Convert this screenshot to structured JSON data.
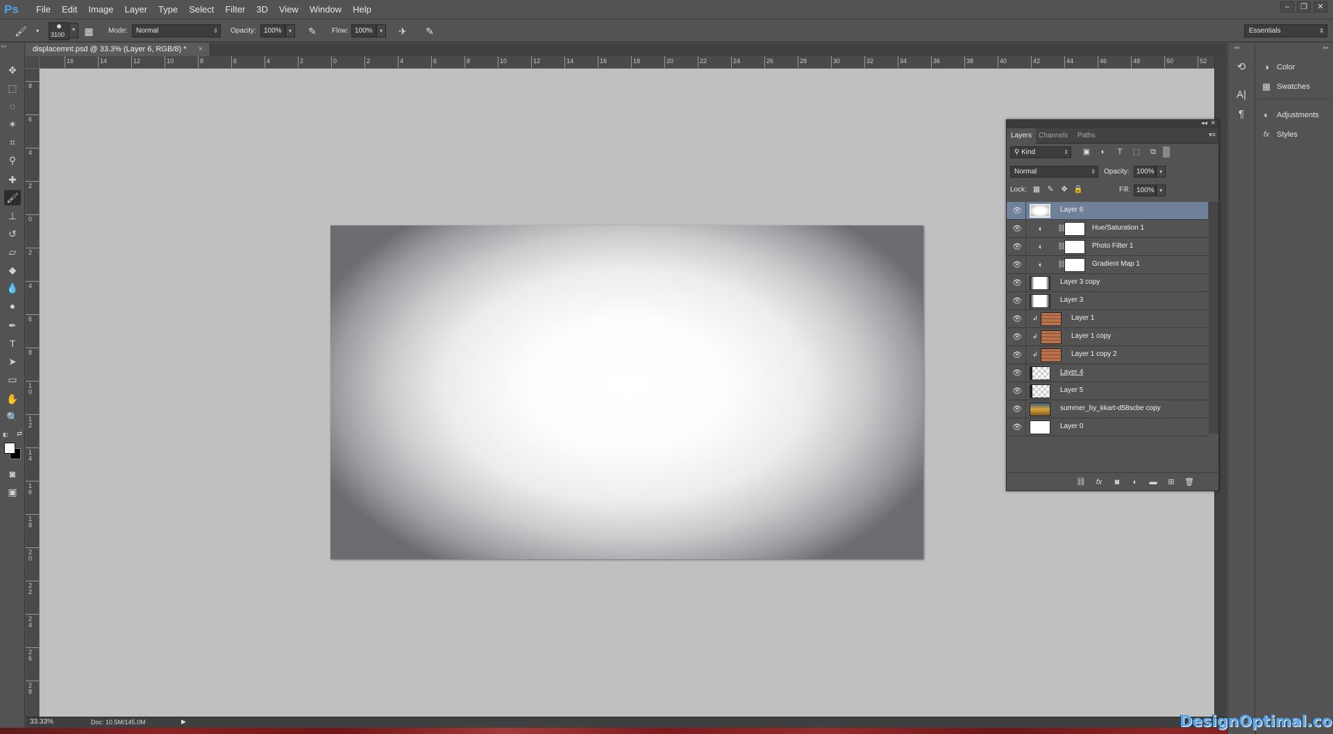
{
  "app": {
    "logo_text": "Ps",
    "accent_color": "#4fa3e6"
  },
  "menu": {
    "items": [
      "File",
      "Edit",
      "Image",
      "Layer",
      "Type",
      "Select",
      "Filter",
      "3D",
      "View",
      "Window",
      "Help"
    ]
  },
  "options_bar": {
    "brush_size": "3100",
    "mode_label": "Mode:",
    "mode_value": "Normal",
    "opacity_label": "Opacity:",
    "opacity_value": "100%",
    "flow_label": "Flow:",
    "flow_value": "100%",
    "workspace": "Essentials"
  },
  "document": {
    "tab_title": "displacemnt.psd @ 33.3% (Layer 6, RGB/8) *",
    "close_glyph": "×"
  },
  "rulers": {
    "top_labels": [
      "16",
      "14",
      "12",
      "10",
      "8",
      "6",
      "4",
      "2",
      "0",
      "2",
      "4",
      "6",
      "8",
      "10",
      "12",
      "14",
      "16",
      "18",
      "20",
      "22",
      "24",
      "26",
      "28",
      "30",
      "32",
      "34",
      "36",
      "38",
      "40",
      "42",
      "44",
      "46",
      "48",
      "50",
      "52"
    ],
    "left_labels": [
      "8",
      "6",
      "4",
      "2",
      "0",
      "2",
      "4",
      "6",
      "8",
      "1 0",
      "1 2",
      "1 4",
      "1 6",
      "1 8",
      "2 0",
      "2 2",
      "2 4",
      "2 6",
      "2 8"
    ]
  },
  "status": {
    "zoom": "33.33%",
    "doc_info": "Doc: 10.5M/145.0M"
  },
  "dock": {
    "items": [
      {
        "label": "Color",
        "icon": "palette-icon"
      },
      {
        "label": "Swatches",
        "icon": "grid-icon"
      },
      {
        "label": "Adjustments",
        "icon": "half-circle-icon"
      },
      {
        "label": "Styles",
        "icon": "fx-icon"
      }
    ]
  },
  "layers_panel": {
    "tabs": [
      "Layers",
      "Channels",
      "Paths"
    ],
    "filter_kind": "Kind",
    "blend_mode": "Normal",
    "opacity_label": "Opacity:",
    "opacity_value": "100%",
    "lock_label": "Lock:",
    "fill_label": "Fill:",
    "fill_value": "100%",
    "layers": [
      {
        "name": "Layer 6",
        "selected": true,
        "thumb": "vignette"
      },
      {
        "name": "Hue/Saturation 1",
        "adjustment": true
      },
      {
        "name": "Photo Filter 1",
        "adjustment": true
      },
      {
        "name": "Gradient Map 1",
        "adjustment": true
      },
      {
        "name": "Layer 3 copy",
        "thumb": "dark"
      },
      {
        "name": "Layer 3",
        "thumb": "dark"
      },
      {
        "name": "Layer 1",
        "clipped": true,
        "thumb": "brick"
      },
      {
        "name": "Layer 1 copy",
        "clipped": true,
        "thumb": "brick"
      },
      {
        "name": "Layer 1 copy 2",
        "clipped": true,
        "thumb": "brick"
      },
      {
        "name": "Layer 4",
        "thumb": "checker"
      },
      {
        "name": "Layer 5",
        "thumb": "checker"
      },
      {
        "name": "summer_by_kkart-d58scbe copy",
        "thumb": "photo"
      },
      {
        "name": "Layer 0",
        "thumb": "white"
      }
    ]
  },
  "watermark": "DesignOptimal.com"
}
